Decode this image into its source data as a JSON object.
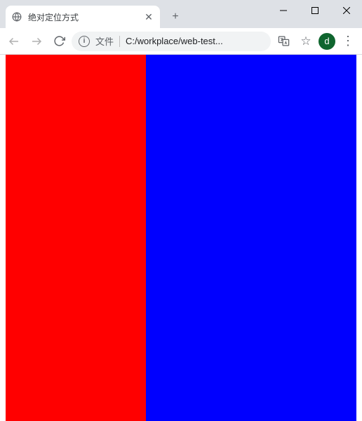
{
  "window": {
    "minimize": "—",
    "maximize": "□",
    "close": "✕"
  },
  "tab": {
    "title": "绝对定位方式",
    "close": "✕"
  },
  "newtab": "+",
  "toolbar": {
    "info": "i",
    "url_prefix": "文件",
    "url": "C:/workplace/web-test...",
    "star": "☆",
    "menu": "⋮"
  },
  "profile": {
    "initial": "d"
  },
  "content": {
    "red_color": "#ff0000",
    "blue_color": "#0000ff"
  }
}
